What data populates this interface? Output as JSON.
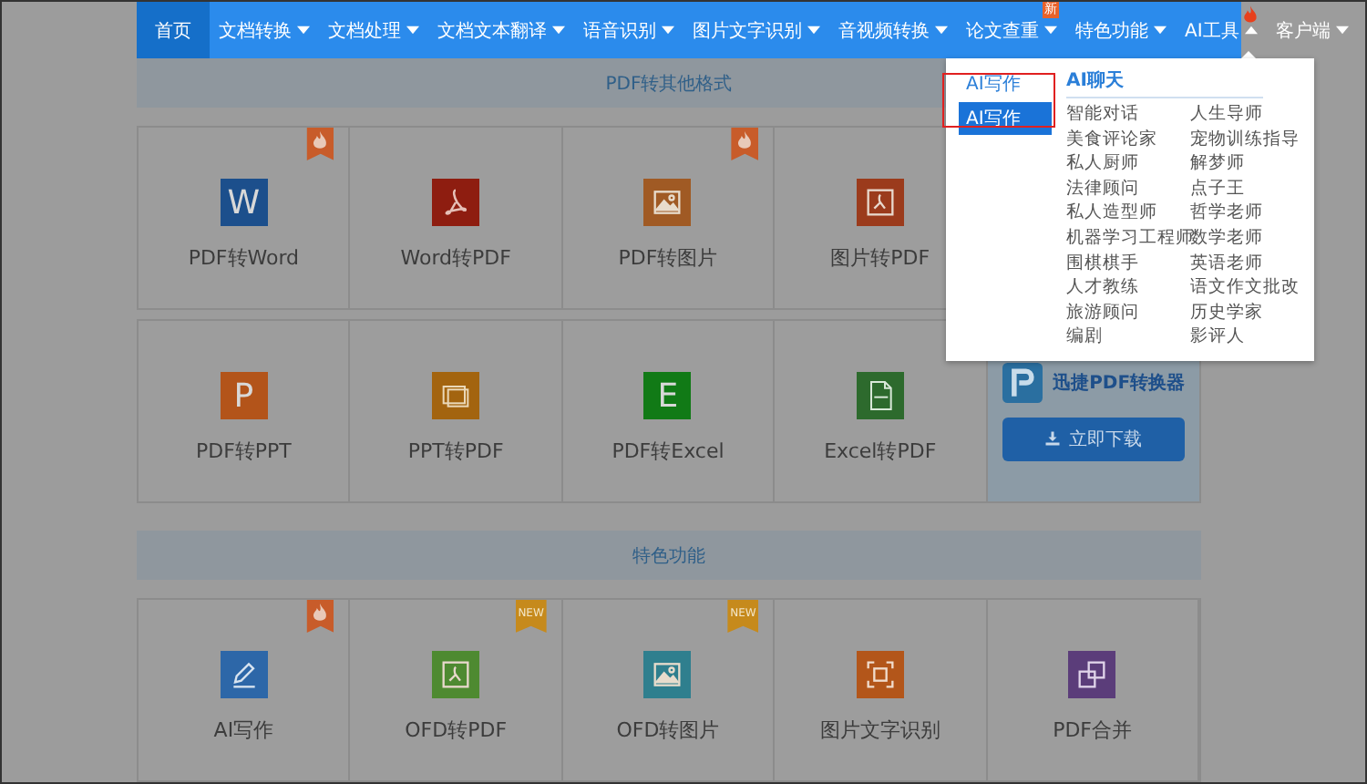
{
  "nav": {
    "items": [
      {
        "label": "首页",
        "selected": true,
        "has_menu": false,
        "expanded": false,
        "hot": false
      },
      {
        "label": "文档转换",
        "selected": false,
        "has_menu": true,
        "expanded": false,
        "hot": false
      },
      {
        "label": "文档处理",
        "selected": false,
        "has_menu": true,
        "expanded": false,
        "hot": false
      },
      {
        "label": "文档文本翻译",
        "selected": false,
        "has_menu": true,
        "expanded": false,
        "hot": false
      },
      {
        "label": "语音识别",
        "selected": false,
        "has_menu": true,
        "expanded": false,
        "hot": false
      },
      {
        "label": "图片文字识别",
        "selected": false,
        "has_menu": true,
        "expanded": false,
        "hot": false
      },
      {
        "label": "音视频转换",
        "selected": false,
        "has_menu": true,
        "expanded": false,
        "hot": false
      },
      {
        "label": "论文查重",
        "selected": false,
        "has_menu": true,
        "expanded": false,
        "hot": false,
        "badge": "新"
      },
      {
        "label": "特色功能",
        "selected": false,
        "has_menu": true,
        "expanded": false,
        "hot": false
      },
      {
        "label": "AI工具",
        "selected": false,
        "has_menu": true,
        "expanded": true,
        "hot": true
      },
      {
        "label": "客户端",
        "selected": false,
        "has_menu": true,
        "expanded": false,
        "hot": false
      }
    ]
  },
  "dropdown": {
    "left_title": "AI写作",
    "left_items": [
      {
        "label": "AI写作",
        "selected": true
      }
    ],
    "right_title": "AI聊天",
    "right_items": [
      "智能对话",
      "人生导师",
      "美食评论家",
      "宠物训练指导",
      "私人厨师",
      "解梦师",
      "法律顾问",
      "点子王",
      "私人造型师",
      "哲学老师",
      "机器学习工程师",
      "数学老师",
      "围棋棋手",
      "英语老师",
      "人才教练",
      "语文作文批改",
      "旅游顾问",
      "历史学家",
      "编剧",
      "影评人"
    ]
  },
  "sections": [
    {
      "title": "PDF转其他格式",
      "rows": [
        [
          {
            "label": "PDF转Word",
            "kind": "letter",
            "glyph": "W",
            "color": "#1c4f8c",
            "hot": true
          },
          {
            "label": "Word转PDF",
            "kind": "pdf",
            "color": "#8e1d10",
            "hot": false
          },
          {
            "label": "PDF转图片",
            "kind": "image",
            "color": "#a05a24",
            "hot": true
          },
          {
            "label": "图片转PDF",
            "kind": "pdfframe",
            "color": "#9b3b1c",
            "hot": false
          }
        ],
        [
          {
            "label": "PDF转PPT",
            "kind": "letter",
            "glyph": "P",
            "color": "#b3541a",
            "hot": false
          },
          {
            "label": "PPT转PDF",
            "kind": "pdfdoc",
            "color": "#a3640f",
            "hot": false
          },
          {
            "label": "PDF转Excel",
            "kind": "letter",
            "glyph": "E",
            "color": "#117a16",
            "hot": false
          },
          {
            "label": "Excel转PDF",
            "kind": "pdffile",
            "color": "#2d6a2d",
            "hot": false
          }
        ]
      ],
      "promo": {
        "title": "迅捷PDF转换器",
        "button": "立即下载"
      }
    },
    {
      "title": "特色功能",
      "rows": [
        [
          {
            "label": "AI写作",
            "kind": "pen",
            "color": "#2d67a8",
            "hot": true
          },
          {
            "label": "OFD转PDF",
            "kind": "pdfframe",
            "color": "#4e8a31",
            "hot": false,
            "badge": "NEW"
          },
          {
            "label": "OFD转图片",
            "kind": "image",
            "color": "#2f7f8e",
            "hot": false,
            "badge": "NEW"
          },
          {
            "label": "图片文字识别",
            "kind": "scan",
            "color": "#b3561a",
            "hot": false
          },
          {
            "label": "PDF合并",
            "kind": "merge",
            "color": "#5b3d7a",
            "hot": false
          }
        ]
      ]
    }
  ]
}
